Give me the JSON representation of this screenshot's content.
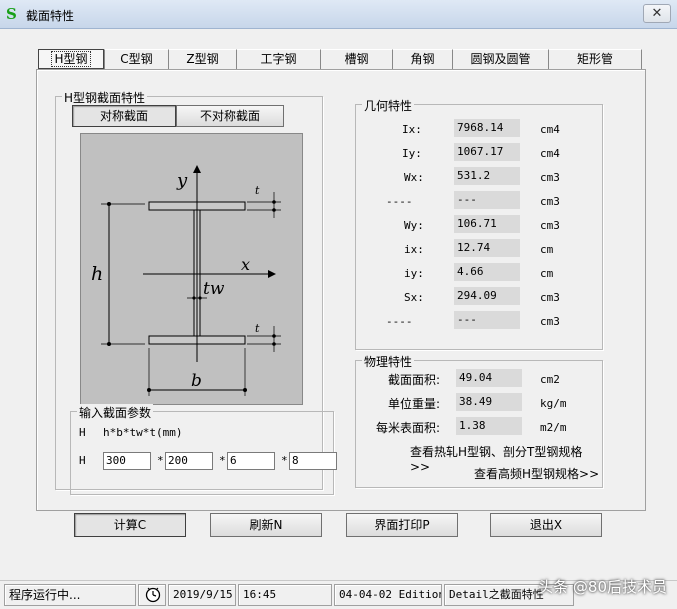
{
  "window": {
    "title": "截面特性",
    "close": "✕"
  },
  "tabs": [
    "H型钢",
    "C型钢",
    "Z型钢",
    "工字钢",
    "槽钢",
    "角钢",
    "圆钢及圆管",
    "矩形管"
  ],
  "section_group": {
    "title": "H型钢截面特性",
    "symmetric_btn": "对称截面",
    "asymmetric_btn": "不对称截面",
    "diagram_labels": {
      "y": "y",
      "x": "x",
      "t_top": "t",
      "t_bottom": "t",
      "tw": "tw",
      "h": "h",
      "b": "b"
    }
  },
  "geometry": {
    "title": "几何特性",
    "rows": [
      {
        "label": "Ix:",
        "value": "7968.14",
        "unit": "cm4"
      },
      {
        "label": "Iy:",
        "value": "1067.17",
        "unit": "cm4"
      },
      {
        "label": "Wx:",
        "value": "531.2",
        "unit": "cm3"
      },
      {
        "label": "----",
        "value": "---",
        "unit": "cm3"
      },
      {
        "label": "Wy:",
        "value": "106.71",
        "unit": "cm3"
      },
      {
        "label": "ix:",
        "value": "12.74",
        "unit": "cm"
      },
      {
        "label": "iy:",
        "value": "4.66",
        "unit": "cm"
      },
      {
        "label": "Sx:",
        "value": "294.09",
        "unit": "cm3"
      },
      {
        "label": "----",
        "value": "---",
        "unit": "cm3"
      }
    ]
  },
  "physical": {
    "title": "物理特性",
    "rows": [
      {
        "label": "截面面积:",
        "value": "49.04",
        "unit": "cm2"
      },
      {
        "label": "单位重量:",
        "value": "38.49",
        "unit": "kg/m"
      },
      {
        "label": "每米表面积:",
        "value": "1.38",
        "unit": "m2/m"
      }
    ],
    "link_hot_rolled": "查看热轧H型钢、剖分T型钢规格>>",
    "link_high_freq": "查看高频H型钢规格>>"
  },
  "input_group": {
    "title": "输入截面参数",
    "prefix1": "H",
    "formula": "h*b*tw*t(mm)",
    "prefix2": "H",
    "values": [
      "300",
      "200",
      "6",
      "8"
    ],
    "sep": "*"
  },
  "buttons": {
    "calc": "计算C",
    "refresh": "刷新N",
    "print": "界面打印P",
    "exit": "退出X"
  },
  "status": {
    "running": "程序运行中...",
    "date": "2019/9/15",
    "time": "16:45",
    "edition": "04-04-02 Edition",
    "detail": "Detail之截面特性"
  },
  "watermark": "头条 @80后技术员"
}
